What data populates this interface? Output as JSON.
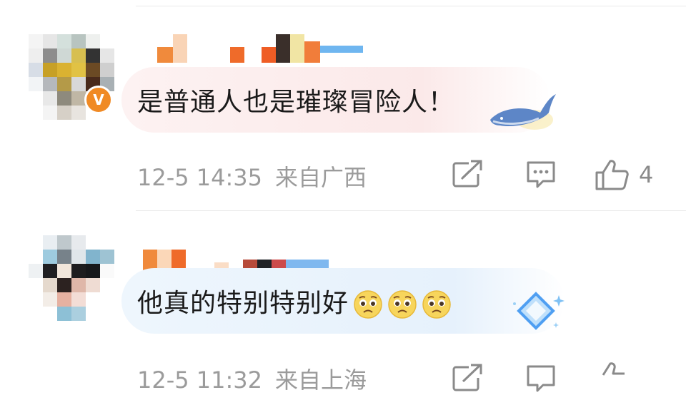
{
  "comments": [
    {
      "text": "是普通人也是璀璨冒险人！",
      "time": "12-5 14:35",
      "location": "来自广西",
      "likes": "4",
      "badge": "V",
      "decoration": "whale-icon"
    },
    {
      "text": "他真的特别特别好",
      "emojis": [
        "pleading-face-emoji",
        "pleading-face-emoji",
        "pleading-face-emoji"
      ],
      "time": "12-5 11:32",
      "location": "来自上海",
      "decoration": "diamond-icon"
    }
  ],
  "icons": [
    "repost-icon",
    "comment-icon",
    "like-icon"
  ],
  "colors": {
    "meta": "#9b9b9b",
    "badge": "#f08a24",
    "text": "#1a1a1a"
  }
}
